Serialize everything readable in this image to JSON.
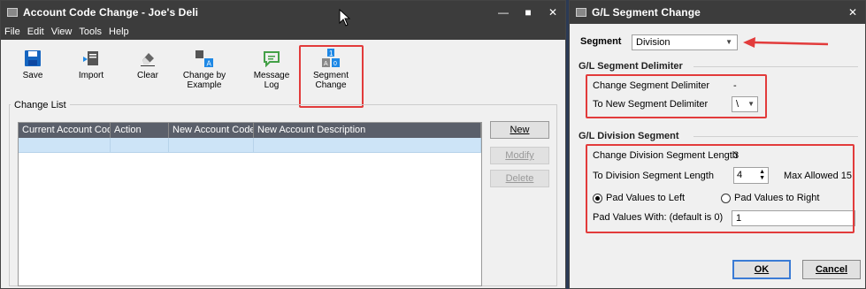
{
  "left": {
    "title": "Account Code Change - Joe's Deli",
    "menu": [
      "File",
      "Edit",
      "View",
      "Tools",
      "Help"
    ],
    "toolbar": [
      {
        "label": "Save"
      },
      {
        "label": "Import"
      },
      {
        "label": "Clear"
      },
      {
        "label": "Change by Example"
      },
      {
        "label": "Message Log"
      },
      {
        "label": "Segment Change"
      }
    ],
    "group_label": "Change List",
    "columns": [
      "Current Account Code",
      "Action",
      "New Account Code",
      "New Account Description"
    ],
    "buttons": {
      "new": "New",
      "modify": "Modify",
      "delete": "Delete"
    }
  },
  "right": {
    "title": "G/L Segment Change",
    "segment_label": "Segment",
    "segment_value": "Division",
    "delim_section": "G/L Segment Delimiter",
    "change_delim_label": "Change Segment Delimiter",
    "change_delim_value": "-",
    "to_delim_label": "To New Segment Delimiter",
    "to_delim_value": "\\",
    "div_section": "G/L Division Segment",
    "change_len_label": "Change Division Segment Length",
    "change_len_value": "3",
    "to_len_label": "To Division Segment Length",
    "to_len_value": "4",
    "max_allowed": "Max Allowed 15",
    "pad_left": "Pad Values to Left",
    "pad_right": "Pad Values to Right",
    "pad_with_label": "Pad Values With: (default is 0)",
    "pad_with_value": "1",
    "ok": "OK",
    "cancel": "Cancel"
  },
  "colors": {
    "highlight": "#e23b3b",
    "titlebar": "#3c3c3c",
    "selection": "#cde4f7"
  }
}
